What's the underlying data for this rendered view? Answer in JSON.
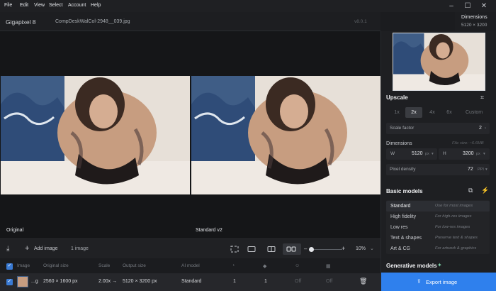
{
  "menu": {
    "items": [
      "File",
      "Edit",
      "View",
      "Select",
      "Account",
      "Help"
    ]
  },
  "titlebar": {
    "app_name": "Gigapixel 8",
    "file_name": "CompDeskWalCol-2948__039.jpg",
    "version": "v8.0.1"
  },
  "dimensions_panel": {
    "title": "Dimensions",
    "value": "5120 × 3200"
  },
  "preview": {
    "left_label": "Original",
    "right_label": "Standard v2"
  },
  "toolbar": {
    "add_image_label": "Add image",
    "image_count": "1 image",
    "zoom": "10%"
  },
  "table": {
    "headers": [
      "Image",
      "Original size",
      "Scale",
      "Output size",
      "AI model"
    ],
    "row": {
      "name": "...g",
      "original_size": "2560 × 1600 px",
      "scale": "2.00x →",
      "output_size": "5120 × 3200 px",
      "model": "Standard",
      "col1": "1",
      "col2": "1",
      "col3": "Off",
      "col4": "Off"
    }
  },
  "upscale": {
    "title": "Upscale",
    "options": [
      "1x",
      "2x",
      "4x",
      "6x",
      "Custom"
    ],
    "selected": "2x",
    "scale_factor_label": "Scale factor",
    "scale_factor_value": "2",
    "dimensions_label": "Dimensions",
    "file_size": "File size: ~6.6MB",
    "width_label": "W",
    "width_value": "5120",
    "width_unit": "px",
    "height_label": "H",
    "height_value": "3200",
    "height_unit": "px",
    "pixel_density_label": "Pixel density",
    "pixel_density_value": "72",
    "pixel_density_unit": "PPI"
  },
  "basic_models": {
    "title": "Basic models",
    "items": [
      {
        "name": "Standard",
        "desc": "Use for most images"
      },
      {
        "name": "High fidelity",
        "desc": "For high-res images"
      },
      {
        "name": "Low res",
        "desc": "For low-res images"
      },
      {
        "name": "Text & shapes",
        "desc": "Preserve text & shapes"
      },
      {
        "name": "Art & CG",
        "desc": "For artwork & graphics"
      }
    ],
    "selected": "Standard"
  },
  "generative_models": {
    "title": "Generative models"
  },
  "export": {
    "label": "Export image"
  },
  "colors": {
    "accent": "#2f80ed",
    "background": "#1b1c1f",
    "panel": "#1e1f22"
  }
}
